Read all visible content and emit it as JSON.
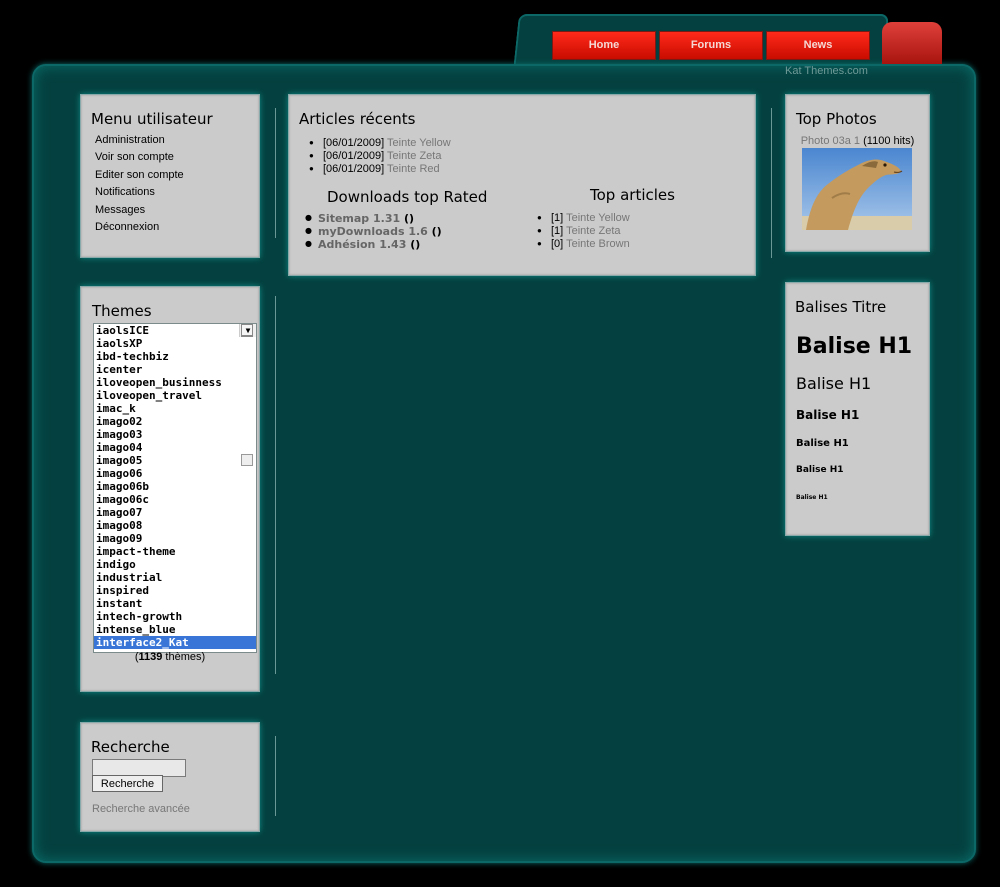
{
  "nav": {
    "items": [
      "Home",
      "Forums",
      "News"
    ],
    "brand": "Kat Themes.com"
  },
  "user_menu": {
    "title": "Menu utilisateur",
    "items": [
      "Administration",
      "Voir son compte",
      "Editer son compte",
      "Notifications",
      "Messages",
      "Déconnexion"
    ]
  },
  "themes": {
    "title": "Themes",
    "items": [
      "iaolsICE",
      "iaolsXP",
      "ibd-techbiz",
      "icenter",
      "iloveopen_businness",
      "iloveopen_travel",
      "imac_k",
      "imago02",
      "imago03",
      "imago04",
      "imago05",
      "imago06",
      "imago06b",
      "imago06c",
      "imago07",
      "imago08",
      "imago09",
      "impact-theme",
      "indigo",
      "industrial",
      "inspired",
      "instant",
      "intech-growth",
      "intense_blue",
      "interface2_Kat"
    ],
    "selected": "interface2_Kat",
    "count_prefix": "(",
    "count": "1139",
    "count_suffix": " thèmes)"
  },
  "search": {
    "title": "Recherche",
    "button": "Recherche",
    "advanced": "Recherche avancée",
    "value": ""
  },
  "recent": {
    "title": "Articles récents",
    "items": [
      {
        "date": "[06/01/2009]",
        "name": "Teinte Yellow"
      },
      {
        "date": "[06/01/2009]",
        "name": "Teinte Zeta"
      },
      {
        "date": "[06/01/2009]",
        "name": "Teinte Red"
      }
    ]
  },
  "downloads": {
    "title": "Downloads top Rated",
    "items": [
      {
        "name": "Sitemap 1.31",
        "paren": "()"
      },
      {
        "name": "myDownloads 1.6",
        "paren": "()"
      },
      {
        "name": "Adhésion 1.43",
        "paren": "()"
      }
    ]
  },
  "top_articles": {
    "title": "Top articles",
    "items": [
      {
        "count": "[1]",
        "name": "Teinte Yellow"
      },
      {
        "count": "[1]",
        "name": "Teinte Zeta"
      },
      {
        "count": "[0]",
        "name": "Teinte Brown"
      }
    ]
  },
  "top_photos": {
    "title": "Top Photos",
    "photo": "Photo 03a 1",
    "hits": "(1100 hits)"
  },
  "headings": {
    "title": "Balises Titre",
    "items": [
      "Balise H1",
      "Balise H1",
      "Balise H1",
      "Balise H1",
      "Balise H1",
      "Balise H1"
    ]
  },
  "colors": {
    "frame": "#04403f",
    "box": "#cbcbcb",
    "nav_red": "#e0201a",
    "selected": "#3875d7"
  }
}
